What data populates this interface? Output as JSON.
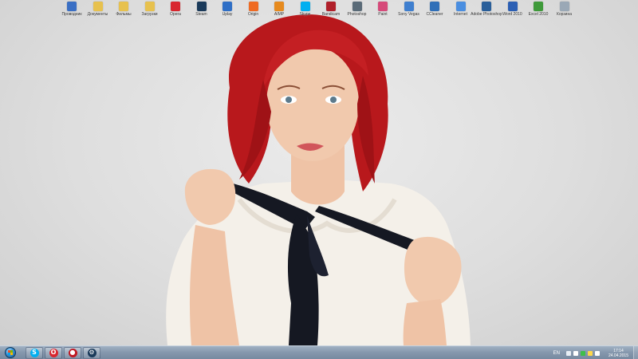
{
  "desktop": {
    "icons": [
      {
        "label": "Проводник",
        "color": "#3a6fc4",
        "icon": "explorer-icon"
      },
      {
        "label": "Документы",
        "color": "#e7c14e",
        "icon": "folder-icon"
      },
      {
        "label": "Фильмы",
        "color": "#e7c14e",
        "icon": "folder-icon"
      },
      {
        "label": "Загрузки",
        "color": "#e7c14e",
        "icon": "folder-icon"
      },
      {
        "label": "Opera",
        "color": "#d8262e",
        "icon": "opera-icon"
      },
      {
        "label": "Steam",
        "color": "#1b3a5a",
        "icon": "steam-icon"
      },
      {
        "label": "Uplay",
        "color": "#2f6fc6",
        "icon": "uplay-icon"
      },
      {
        "label": "Origin",
        "color": "#ef6a22",
        "icon": "origin-icon"
      },
      {
        "label": "AIMP",
        "color": "#e68a1e",
        "icon": "aimp-icon"
      },
      {
        "label": "Skype",
        "color": "#00aff0",
        "icon": "skype-icon"
      },
      {
        "label": "Bandicam",
        "color": "#b0202a",
        "icon": "bandicam-icon"
      },
      {
        "label": "Photoshop",
        "color": "#5a6b78",
        "icon": "photoshop-icon"
      },
      {
        "label": "Paint",
        "color": "#d64a7a",
        "icon": "paint-icon"
      },
      {
        "label": "Sony Vegas",
        "color": "#3f7fcf",
        "icon": "vegas-icon"
      },
      {
        "label": "CCleaner",
        "color": "#2f6fb8",
        "icon": "ccleaner-icon"
      },
      {
        "label": "Internet",
        "color": "#4a8ee0",
        "icon": "network-icon"
      },
      {
        "label": "Adobe Photoshop",
        "color": "#2a5f9a",
        "icon": "photoshop-cs-icon"
      },
      {
        "label": "Word 2010",
        "color": "#2b5fb4",
        "icon": "word-icon"
      },
      {
        "label": "Excel 2010",
        "color": "#3f9a3a",
        "icon": "excel-icon"
      },
      {
        "label": "Корзина",
        "color": "#9aa8b6",
        "icon": "recycle-bin-icon"
      }
    ]
  },
  "taskbar": {
    "pinned": [
      {
        "name": "skype",
        "glyph": "S",
        "color": "#00aff0",
        "icon": "skype-icon"
      },
      {
        "name": "opera",
        "glyph": "O",
        "color": "#d8262e",
        "icon": "opera-icon"
      },
      {
        "name": "bandicam",
        "glyph": "●",
        "color": "#c01822",
        "icon": "bandicam-icon"
      },
      {
        "name": "steam",
        "glyph": "⚙",
        "color": "#1b3a5a",
        "icon": "steam-icon"
      }
    ],
    "tray": {
      "language": "EN",
      "icons": [
        {
          "name": "up-arrow-icon",
          "color": "#e8eef5"
        },
        {
          "name": "network-icon",
          "color": "#ffffff"
        },
        {
          "name": "update-icon",
          "color": "#3fbf4a"
        },
        {
          "name": "volume-icon",
          "color": "#ffd84a"
        },
        {
          "name": "flag-icon",
          "color": "#ffffff"
        }
      ],
      "time": "17:14",
      "date": "24.04.2015"
    }
  },
  "colors": {
    "hair": "#b8181c",
    "ribbon": "#151822",
    "blouse": "#f4f0e9"
  }
}
